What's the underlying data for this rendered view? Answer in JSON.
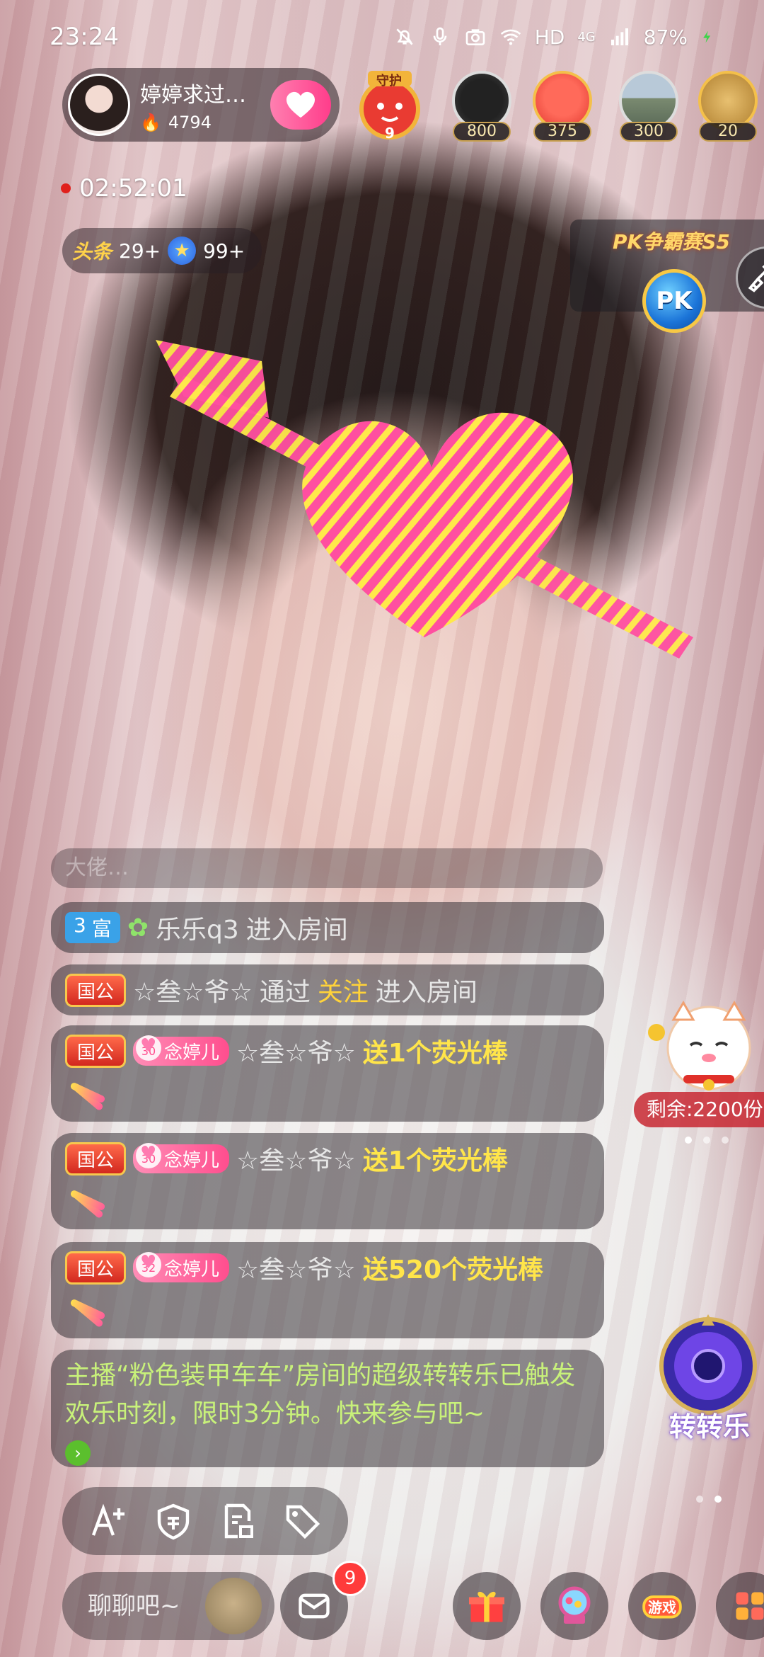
{
  "status_bar": {
    "time": "23:24",
    "hd": "HD",
    "network": "4G",
    "battery": "87%"
  },
  "host": {
    "name": "婷婷求过…",
    "heat": "4794"
  },
  "viewers": [
    {
      "badge": "800"
    },
    {
      "badge": "375"
    },
    {
      "badge": "300"
    },
    {
      "badge": "20"
    }
  ],
  "guard_label": "守护",
  "guard_level": "9",
  "live_timer": "02:52:01",
  "rank": {
    "toutiao_label": "头条",
    "toutiao_count": "29+",
    "star_count": "99+"
  },
  "pk": {
    "title": "PK争霸赛S5",
    "button_label": "PK"
  },
  "chat": {
    "faded_preview": "大佬…",
    "messages": [
      {
        "rich_level": "3",
        "rich_label": "富",
        "user": "乐乐q3",
        "action": "进入房间"
      },
      {
        "guo_tag": "国公",
        "user": "☆叁☆爷☆",
        "via": "通过",
        "via_action": "关注",
        "action": "进入房间"
      },
      {
        "guo_tag": "国公",
        "fan_level": "30",
        "fan_name": "念婷儿",
        "user": "☆叁☆爷☆",
        "gift": "送1个荧光棒"
      },
      {
        "guo_tag": "国公",
        "fan_level": "30",
        "fan_name": "念婷儿",
        "user": "☆叁☆爷☆",
        "gift": "送1个荧光棒"
      },
      {
        "guo_tag": "国公",
        "fan_level": "32",
        "fan_name": "念婷儿",
        "user": "☆叁☆爷☆",
        "gift": "送520个荧光棒"
      }
    ],
    "system_message": "主播“粉色装甲车车”房间的超级转转乐已触发欢乐时刻，限时3分钟。快来参与吧~"
  },
  "widgets": {
    "lucky_remaining": "剩余:2200份",
    "wheel_label": "转转乐"
  },
  "bottom": {
    "chat_placeholder": "聊聊吧~",
    "message_count": "9",
    "game_label": "游戏"
  },
  "colors": {
    "accent_pink": "#ff3d8b",
    "gold": "#ffd23a",
    "system_green": "#c8f17a"
  }
}
